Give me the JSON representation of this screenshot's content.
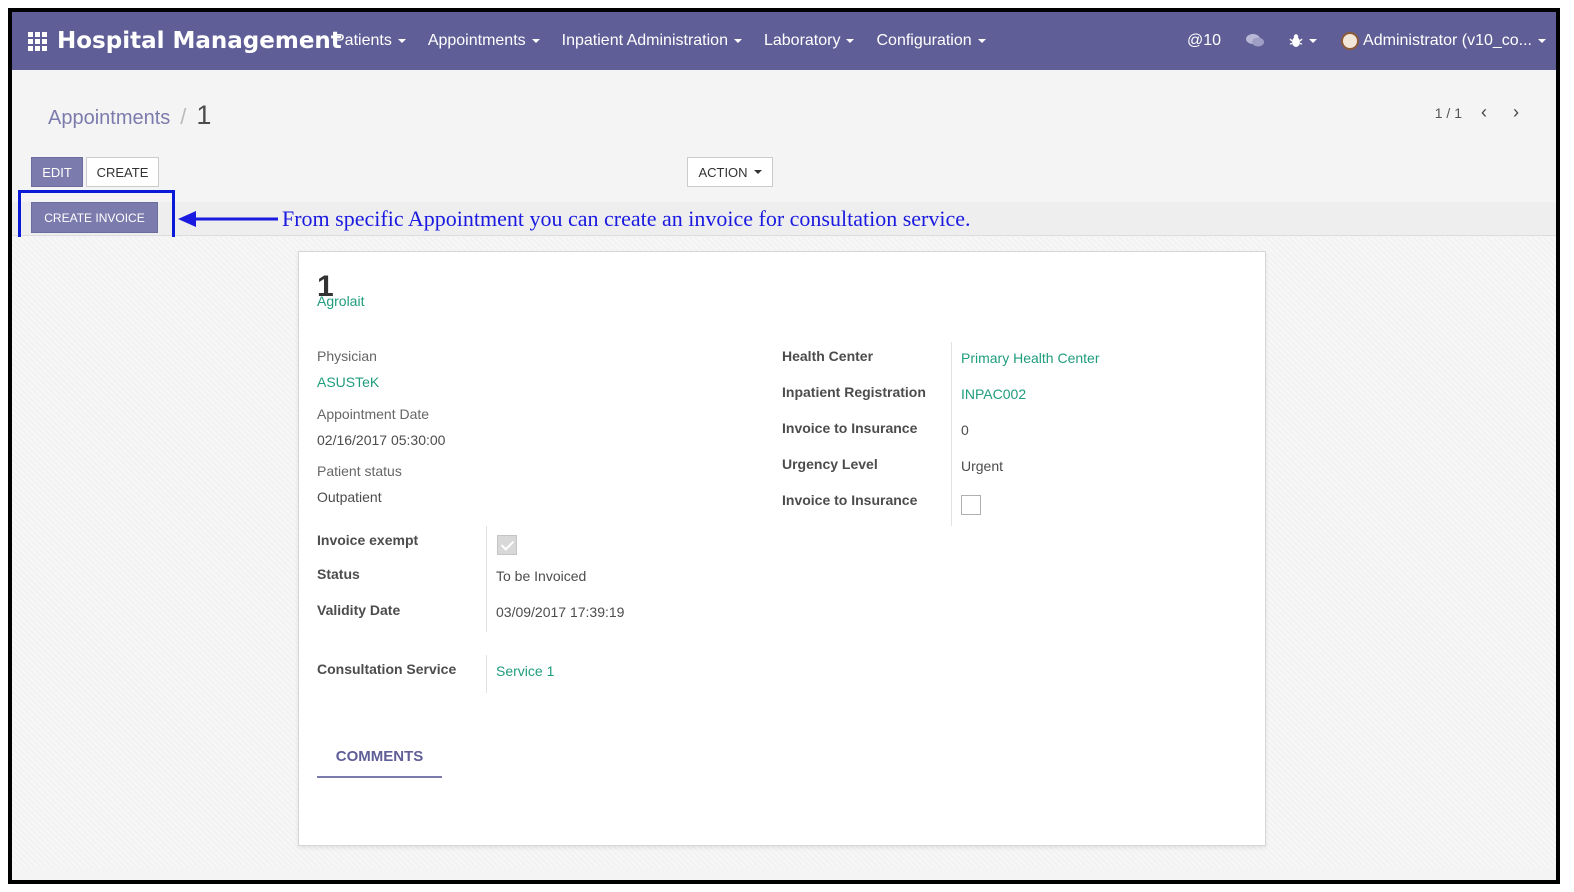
{
  "navbar": {
    "brand": "Hospital Management",
    "menu": [
      "Patients",
      "Appointments",
      "Inpatient Administration",
      "Laboratory",
      "Configuration"
    ],
    "mentions": "@10",
    "user": "Administrator (v10_co..."
  },
  "breadcrumb": {
    "parent": "Appointments",
    "separator": "/",
    "current": "1"
  },
  "buttons": {
    "edit": "EDIT",
    "create": "CREATE",
    "action": "ACTION",
    "create_invoice": "CREATE INVOICE"
  },
  "pager": {
    "value": "1 / 1"
  },
  "annotation": "From specific Appointment you can create an invoice for consultation service.",
  "record": {
    "number": "1",
    "patient": "Agrolait",
    "physician_label": "Physician",
    "physician": "ASUSTeK",
    "date_label": "Appointment Date",
    "date": "02/16/2017 05:30:00",
    "patient_status_label": "Patient status",
    "patient_status": "Outpatient",
    "invoice_exempt_label": "Invoice exempt",
    "invoice_exempt": true,
    "status_label": "Status",
    "status": "To be Invoiced",
    "validity_label": "Validity Date",
    "validity": "03/09/2017 17:39:19",
    "consultation_label": "Consultation Service",
    "consultation": "Service 1",
    "health_center_label": "Health Center",
    "health_center": "Primary Health Center",
    "inpatient_label": "Inpatient Registration",
    "inpatient": "INPAC002",
    "invoice_insurance_label": "Invoice to Insurance",
    "invoice_insurance_value": "0",
    "urgency_label": "Urgency Level",
    "urgency": "Urgent",
    "invoice_insurance2_label": "Invoice to Insurance",
    "invoice_insurance2": false
  },
  "tabs": {
    "comments": "COMMENTS"
  }
}
